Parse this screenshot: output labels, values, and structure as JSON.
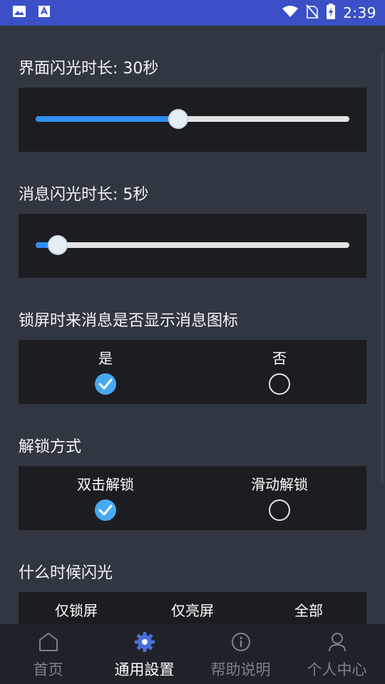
{
  "status_bar": {
    "time": "2:39",
    "icons": [
      "image-icon",
      "text-a-icon",
      "wifi-icon",
      "no-sim-icon",
      "battery-charging-icon"
    ]
  },
  "settings": {
    "screen_flash": {
      "title": "界面闪光时长: 30秒",
      "value_fraction": 0.455
    },
    "msg_flash": {
      "title": "消息闪光时长: 5秒",
      "value_fraction": 0.07
    },
    "lock_icon": {
      "title": "锁屏时来消息是否显示消息图标",
      "options": [
        {
          "label": "是",
          "checked": true
        },
        {
          "label": "否",
          "checked": false
        }
      ]
    },
    "unlock": {
      "title": "解锁方式",
      "options": [
        {
          "label": "双击解锁",
          "checked": true
        },
        {
          "label": "滑动解锁",
          "checked": false
        }
      ]
    },
    "when_flash": {
      "title": "什么时候闪光",
      "options": [
        {
          "label": "仅锁屏"
        },
        {
          "label": "仅亮屏"
        },
        {
          "label": "全部"
        }
      ]
    }
  },
  "nav": {
    "items": [
      {
        "label": "首页",
        "icon": "home-icon"
      },
      {
        "label": "通用設置",
        "icon": "gear-icon",
        "active": true
      },
      {
        "label": "帮助说明",
        "icon": "info-icon"
      },
      {
        "label": "个人中心",
        "icon": "person-icon"
      }
    ]
  },
  "colors": {
    "accent": "#2f8ef2",
    "check": "#47a9f2",
    "status_bar": "#3b50c6",
    "background": "#303741",
    "panel": "#1c1d21",
    "nav_bg": "#20222a"
  }
}
